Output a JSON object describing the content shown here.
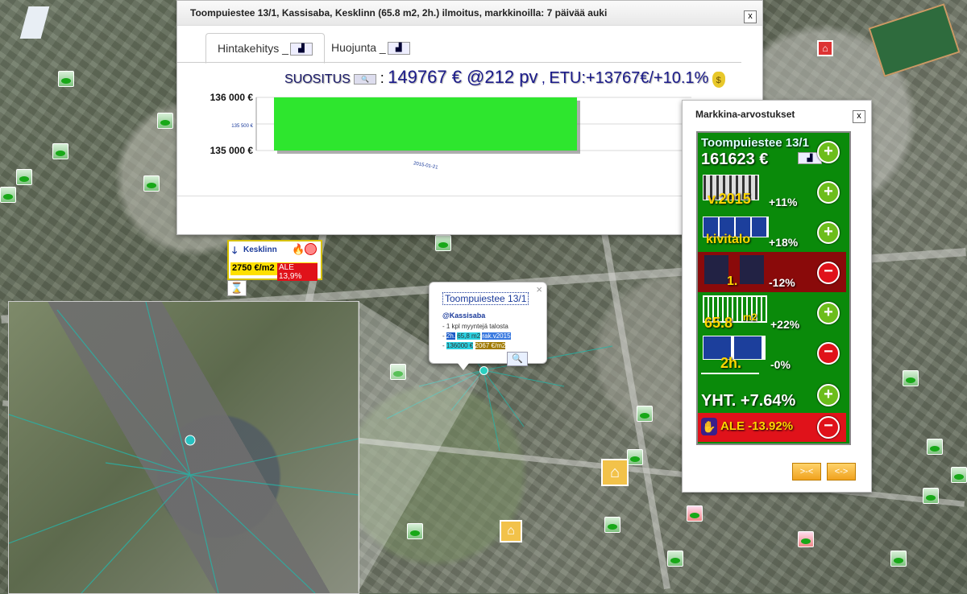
{
  "colors": {
    "bar_green": "#2ee62e",
    "panel_green": "#0a8a0a",
    "panel_red": "#8a0a0a",
    "accent_blue": "#1a1a8a",
    "ale_red": "#e0121a"
  },
  "listing_window": {
    "title": "Toompuiestee 13/1, Kassisaba, Kesklinn (65.8 m2, 2h.) ilmoitus, markkinoilla: 7 päivää auki",
    "close_label": "x",
    "tabs": [
      {
        "label": "Hintakehitys _",
        "active": true
      },
      {
        "label": "Huojunta _",
        "active": false
      }
    ],
    "recommendation": {
      "label": "SUOSITUS",
      "search_icon": "magnifier-icon",
      "colon": ":",
      "price": "149767 € @212 pv",
      "separator": ",",
      "benefit": "ETU:+13767€/+10.1%",
      "money_icon": "money-bag-icon"
    }
  },
  "chart_data": {
    "type": "bar",
    "categories": [
      "2015-01-21"
    ],
    "values": [
      136000
    ],
    "ylim": [
      135000,
      136000
    ],
    "yticks": [
      "136 000 €",
      "135 500 €",
      "135 000 €"
    ],
    "xlabel": "",
    "ylabel": ""
  },
  "market_window": {
    "title": "Markkina-arvostukset",
    "close_label": "x",
    "address": "Toompuiestee 13/1",
    "value": "161623 €",
    "rows": [
      {
        "label": "v.2015",
        "pct": "+11%",
        "kind": "plus",
        "icon": "building-age-icon"
      },
      {
        "label": "kivitalo",
        "pct": "+18%",
        "kind": "plus",
        "icon": "brick-wall-icon"
      },
      {
        "label": "1.",
        "pct": "-12%",
        "kind": "minus",
        "icon": "floor-icon"
      },
      {
        "label": "65.8",
        "unit": "m2",
        "pct": "+22%",
        "kind": "plus",
        "icon": "floor-plan-icon"
      },
      {
        "label": "2h.",
        "pct": "-0%",
        "kind": "minus",
        "icon": "rooms-icon"
      }
    ],
    "total": "YHT. +7.64%",
    "ale": "ALE -13.92%",
    "buttons": [
      ">-<",
      "<->"
    ]
  },
  "area_badge": {
    "name": "Kesklinn",
    "price": "2750 €/m2",
    "ale": "ALE 13,9%"
  },
  "map_popup": {
    "title": "Toompuiestee 13/1",
    "district": "@Kassisaba",
    "lines": [
      "- 1 kpl myyntejä talosta"
    ],
    "chips": [
      {
        "parts": [
          "2h.",
          "65,8 m2",
          "rak.v2015"
        ]
      },
      {
        "parts": [
          "136000 €",
          "2067 €/m2"
        ]
      }
    ],
    "close_label": "×",
    "zoom_icon": "zoom-in-icon"
  }
}
